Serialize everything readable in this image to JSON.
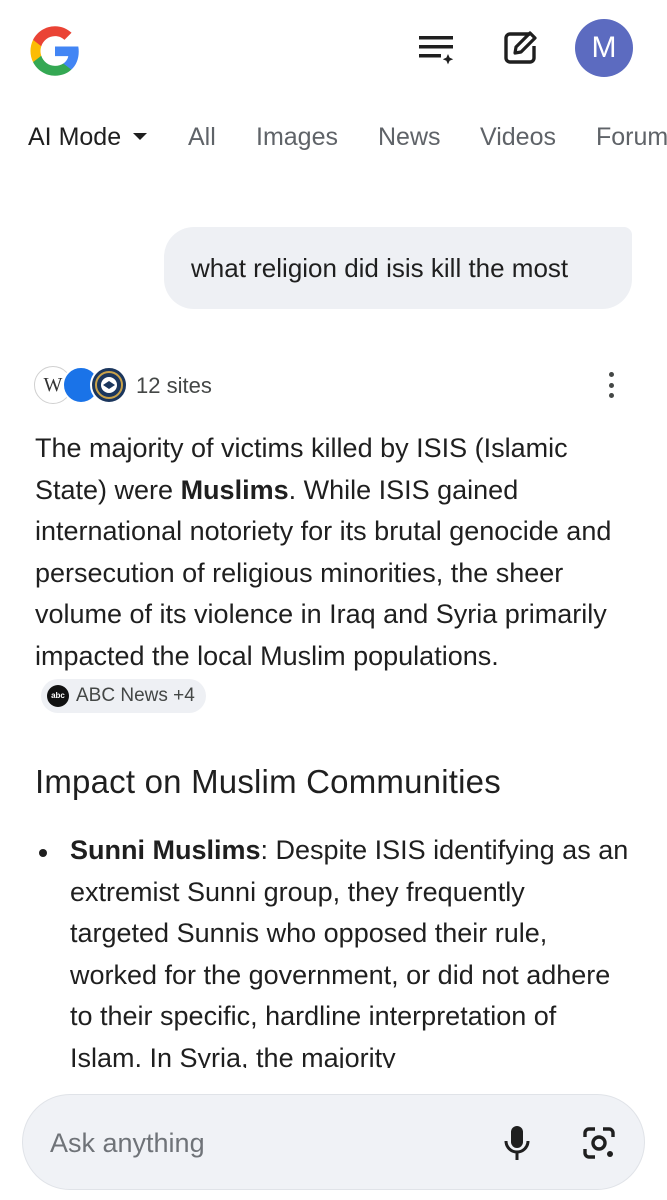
{
  "header": {
    "logo": "G",
    "avatar_letter": "M",
    "icons": [
      "search-history-icon",
      "new-chat-icon"
    ]
  },
  "tabs": [
    {
      "label": "AI Mode",
      "active": true
    },
    {
      "label": "All"
    },
    {
      "label": "Images"
    },
    {
      "label": "News"
    },
    {
      "label": "Videos"
    },
    {
      "label": "Forums"
    }
  ],
  "query": "what religion did isis kill the most",
  "sources": {
    "count_label": "12 sites",
    "wiki_letter": "W"
  },
  "answer": {
    "p1_before": "The majority of victims killed by ISIS (Islamic State) were ",
    "p1_bold": "Muslims",
    "p1_after": ". While ISIS gained international notoriety for its brutal genocide and persecution of religious minorities, the sheer volume of its violence in Iraq and Syria primarily impacted the local Muslim populations.",
    "chip_label": "ABC News +4",
    "chip_logo": "abc"
  },
  "section": {
    "title": "Impact on Muslim Communities",
    "bullet_bold": "Sunni Muslims",
    "bullet_text": ": Despite ISIS identifying as an extremist Sunni group, they frequently targeted Sunnis who opposed their rule, worked for the government, or did not adhere to their specific, hardline interpretation of Islam. In Syria, the majority"
  },
  "ask": {
    "placeholder": "Ask anything"
  },
  "colors": {
    "avatar": "#5c6bc0",
    "bubble": "#eef0f4",
    "text": "#1f1f1f",
    "muted": "#5f6368"
  }
}
